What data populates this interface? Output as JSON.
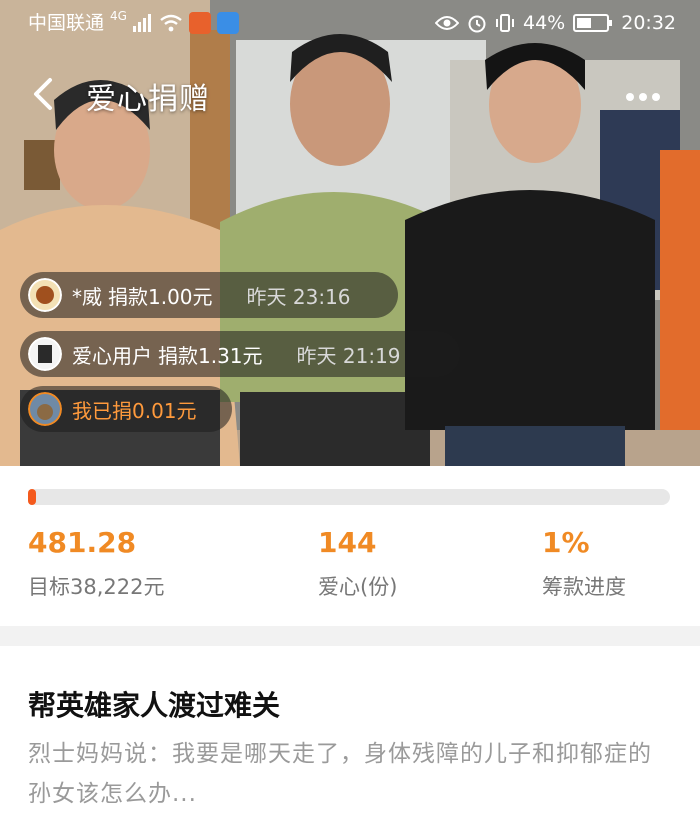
{
  "status_bar": {
    "carrier": "中国联通",
    "network": "4G",
    "battery": "44%",
    "time": "20:32"
  },
  "nav": {
    "title": "爱心捐赠",
    "back_icon": "chevron-left-icon",
    "more_icon": "more-dots-icon"
  },
  "donations": [
    {
      "donor": "*威",
      "action": "捐款1.00元",
      "time": "昨天 23:16"
    },
    {
      "donor": "爱心用户",
      "action": "捐款1.31元",
      "time": "昨天 21:19"
    }
  ],
  "self_donation": {
    "text": "我已捐0.01元"
  },
  "progress": {
    "fraction": 0.012,
    "color": "#f45a1d"
  },
  "stats": {
    "raised": {
      "value": "481.28",
      "label": "目标38,222元"
    },
    "hearts": {
      "value": "144",
      "label": "爱心(份)"
    },
    "percent": {
      "value": "1%",
      "label": "筹款进度"
    }
  },
  "story": {
    "title": "帮英雄家人渡过难关",
    "excerpt": "烈士妈妈说：我要是哪天走了，身体残障的儿子和抑郁症的孙女该怎么办..."
  },
  "colors": {
    "accent": "#f08a24",
    "muted": "#777777"
  }
}
